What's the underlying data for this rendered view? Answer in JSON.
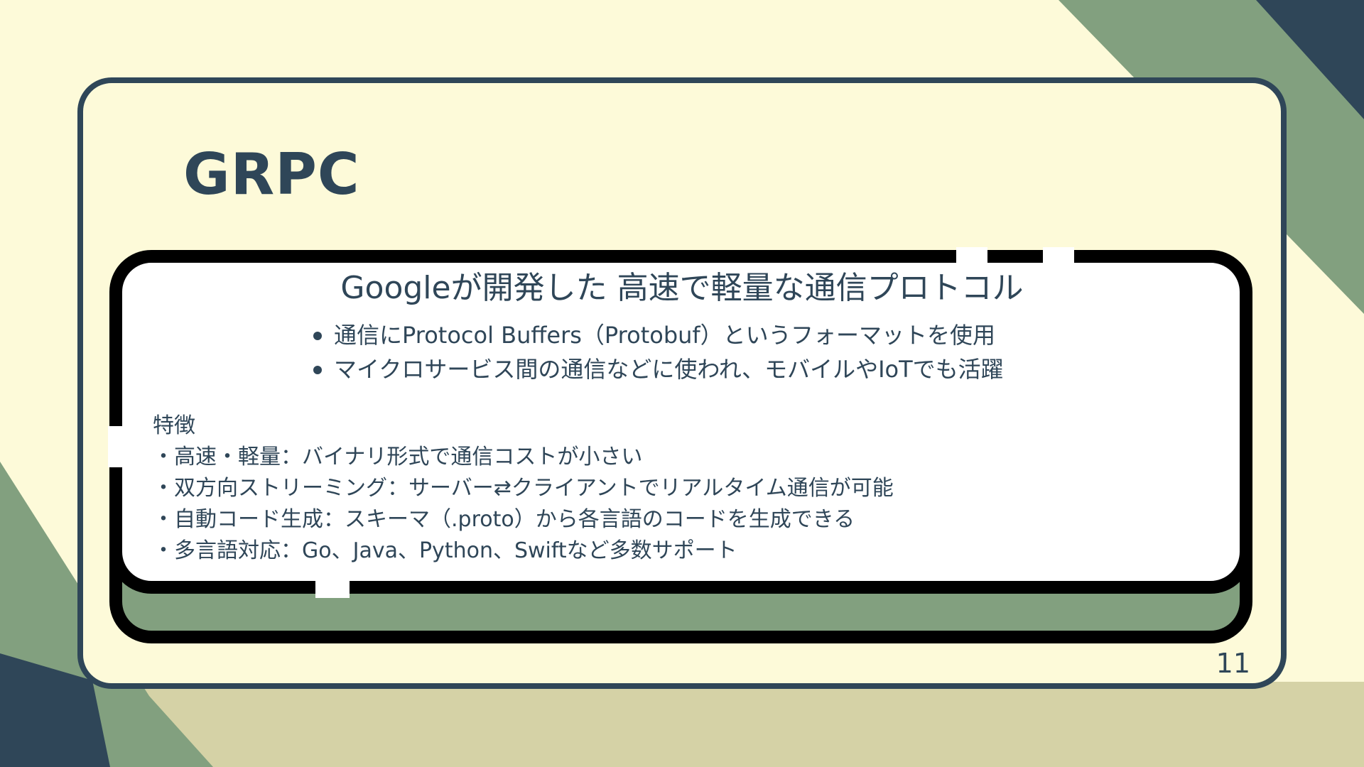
{
  "slide": {
    "title": "GRPC",
    "headline": "Googleが開発した 高速で軽量な通信プロトコル",
    "bullets": [
      "通信にProtocol Buffers（Protobuf）というフォーマットを使用",
      "マイクロサービス間の通信などに使われ、モバイルやIoTでも活躍"
    ],
    "features": {
      "heading": "特徴",
      "items": [
        "・高速・軽量：バイナリ形式で通信コストが小さい",
        "・双方向ストリーミング：サーバー⇄クライアントでリアルタイム通信が可能",
        "・自動コード生成：スキーマ（.proto）から各言語のコードを生成できる",
        "・多言語対応：Go、Java、Python、Swiftなど多数サポート"
      ]
    },
    "page_number": "11"
  },
  "colors": {
    "background": "#fdfad9",
    "navy": "#2f4658",
    "sage": "#82a07f",
    "sand": "#d5d2a6",
    "card_fill": "#ffffff",
    "outline": "#000000"
  }
}
